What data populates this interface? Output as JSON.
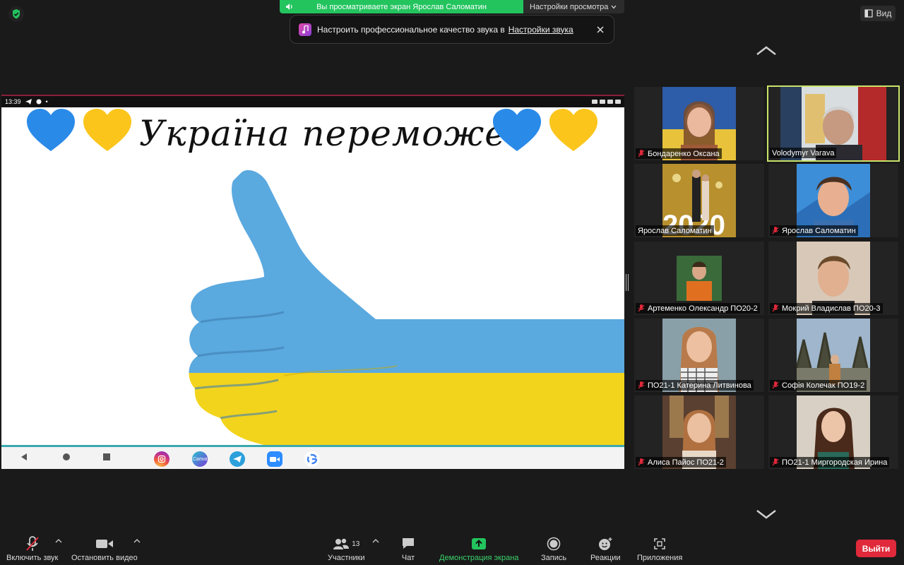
{
  "banner": {
    "sharing_text": "Вы просматриваете экран Ярослав Саломатин",
    "view_options": "Настройки просмотра",
    "view_button": "Вид"
  },
  "notice": {
    "text": "Настроить профессиональное качество звука в",
    "link": "Настройки звука"
  },
  "shared_screen": {
    "status_time": "13:39",
    "headline": "Україна переможе!",
    "apps": [
      "instagram-icon",
      "canva-icon",
      "telegram-icon",
      "zoom-icon",
      "google-icon"
    ],
    "canva_label": "Canva"
  },
  "participants": [
    {
      "name": "Бондаренко Оксана",
      "muted": true,
      "active": false
    },
    {
      "name": "Volodymyr Varava",
      "muted": false,
      "active": true
    },
    {
      "name": "Ярослав Саломатин",
      "muted": false,
      "active": false
    },
    {
      "name": "Ярослав Саломатин",
      "muted": true,
      "active": false
    },
    {
      "name": "Артеменко Олександр ПО20-2",
      "muted": true,
      "active": false
    },
    {
      "name": "Мокрий Владислав ПО20-3",
      "muted": true,
      "active": false
    },
    {
      "name": "ПО21-1 Катерина Литвинова",
      "muted": true,
      "active": false
    },
    {
      "name": "Софія Колечак ПО19-2",
      "muted": true,
      "active": false
    },
    {
      "name": "Алиса Пайос ПО21-2",
      "muted": true,
      "active": false
    },
    {
      "name": "ПО21-1 Миргородская Ирина",
      "muted": true,
      "active": false
    }
  ],
  "toolbar": {
    "unmute": "Включить звук",
    "stop_video": "Остановить видео",
    "participants": "Участники",
    "participants_count": "13",
    "chat": "Чат",
    "share_screen": "Демонстрация экрана",
    "record": "Запись",
    "reactions": "Реакции",
    "apps": "Приложения",
    "leave": "Выйти"
  },
  "colors": {
    "share_green": "#23c45e",
    "leave_red": "#e0293a",
    "active_border": "#c8e36a",
    "flag_blue": "#5aa9df",
    "flag_yellow": "#f3d41c"
  }
}
